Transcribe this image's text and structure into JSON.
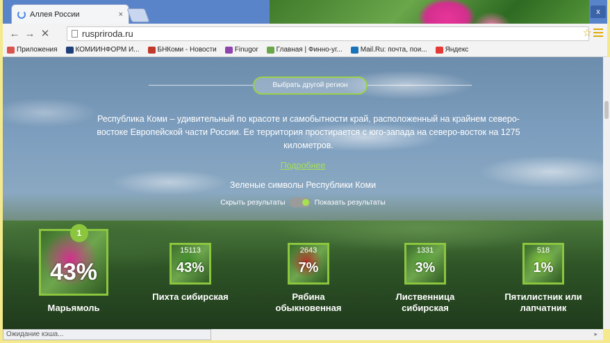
{
  "browser": {
    "tab_title": "Аллея России",
    "tab_close": "×",
    "window_close": "x",
    "url": "rusprirodа.ru",
    "status": "Ожидание кэша...",
    "bookmarks": [
      {
        "label": "Приложения",
        "icon": "apps-icon",
        "color": "#d9534f"
      },
      {
        "label": "КОМИИНФОРМ И...",
        "icon": "komiinform-icon",
        "color": "#1f3f7a"
      },
      {
        "label": "БНКоми - Новости",
        "icon": "bnkomi-icon",
        "color": "#c0392b"
      },
      {
        "label": "Finugor",
        "icon": "finugor-icon",
        "color": "#8e44ad"
      },
      {
        "label": "Главная | Финно-уг...",
        "icon": "finno-icon",
        "color": "#6aa64a"
      },
      {
        "label": "Mail.Ru: почта, пои...",
        "icon": "mail-icon",
        "color": "#1a73b8"
      },
      {
        "label": "Яндекс",
        "icon": "yandex-icon",
        "color": "#e53935"
      }
    ]
  },
  "page": {
    "region_button": "Выбрать другой регион",
    "description": "Республика Коми – удивительный по красоте и самобытности край, расположенный на крайнем северо-востоке Европейской части России. Ее территория простирается с юго-запада на северо-восток на 1275 километров.",
    "more_link": "Подробнее",
    "symbols_title": "Зеленые символы Республики Коми",
    "hide_results": "Скрыть результаты",
    "show_results": "Показать результаты",
    "leader_badge": "1",
    "cards": [
      {
        "name": "Марьямоль",
        "count": "",
        "percent": "43%",
        "share": 43,
        "image": "peony-flower",
        "accent": "#d22f8d"
      },
      {
        "name": "Пихта сибирская",
        "count": "15113",
        "percent": "43%",
        "share": 43,
        "image": "fir-branch",
        "accent": "#3f8a2b"
      },
      {
        "name": "Рябина обыкновенная",
        "count": "2643",
        "percent": "7%",
        "share": 7,
        "image": "rowan-berries",
        "accent": "#b5332a"
      },
      {
        "name": "Лиственница сибирская",
        "count": "1331",
        "percent": "3%",
        "share": 3,
        "image": "larch-branch",
        "accent": "#5aa23a"
      },
      {
        "name": "Пятилистник или лапчатник",
        "count": "518",
        "percent": "1%",
        "share": 1,
        "image": "potentilla-flower",
        "accent": "#7fbf3a"
      }
    ]
  }
}
